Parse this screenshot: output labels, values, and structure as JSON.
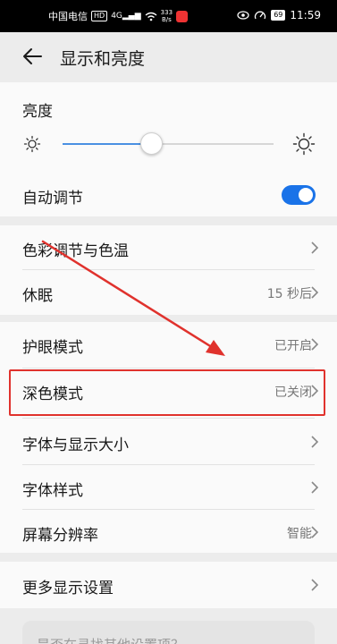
{
  "status_bar": {
    "carrier": "中国电信",
    "hd": "HD",
    "net": "4G",
    "speed_value": "333",
    "speed_unit": "B/s",
    "battery": "69",
    "time": "11:59"
  },
  "header": {
    "title": "显示和亮度"
  },
  "brightness": {
    "label": "亮度",
    "level": 0.42
  },
  "auto_adjust": {
    "label": "自动调节",
    "enabled": true
  },
  "group1": {
    "color_temp": {
      "label": "色彩调节与色温"
    },
    "sleep": {
      "label": "休眠",
      "value": "15 秒后"
    }
  },
  "group2": {
    "eye_comfort": {
      "label": "护眼模式",
      "value": "已开启"
    },
    "dark_mode": {
      "label": "深色模式",
      "value": "已关闭"
    },
    "font_size": {
      "label": "字体与显示大小"
    },
    "font_style": {
      "label": "字体样式"
    },
    "resolution": {
      "label": "屏幕分辨率",
      "value": "智能"
    }
  },
  "more": {
    "label": "更多显示设置"
  },
  "tip": {
    "text": "是否在寻找其他设置项？"
  },
  "colors": {
    "accent": "#1a73e8",
    "annotation": "#e0322d",
    "background": "#ececec",
    "card": "#fafafa"
  }
}
